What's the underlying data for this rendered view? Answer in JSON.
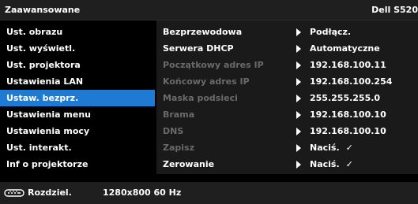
{
  "header": {
    "title": "Zaawansowane",
    "brand": "Dell S520"
  },
  "menu": {
    "items": [
      {
        "label": "Ust. obrazu"
      },
      {
        "label": "Ust. wyświetl."
      },
      {
        "label": "Ust. projektora"
      },
      {
        "label": "Ustawienia LAN"
      },
      {
        "label": "Ustaw. bezprz."
      },
      {
        "label": "Ustawienia menu"
      },
      {
        "label": "Ustawienia mocy"
      },
      {
        "label": "Ust. interakt."
      },
      {
        "label": "Inf o projektorze"
      }
    ],
    "selected_index": 4
  },
  "panel": {
    "rows": [
      {
        "label": "Bezprzewodowa",
        "value": "Podłącz.",
        "dim": false
      },
      {
        "label": "Serwera DHCP",
        "value": "Automatyczne",
        "dim": false
      },
      {
        "label": "Początkowy adres IP",
        "value": "192.168.100.11",
        "dim": true
      },
      {
        "label": "Końcowy adres IP",
        "value": "192.168.100.254",
        "dim": true
      },
      {
        "label": "Maska podsieci",
        "value": "255.255.255.0",
        "dim": true
      },
      {
        "label": "Brama",
        "value": "192.168.100.10",
        "dim": true
      },
      {
        "label": "DNS",
        "value": "192.168.100.10",
        "dim": true
      },
      {
        "label": "Zapisz",
        "value": "Naciś.",
        "check": "✓",
        "dim": true
      },
      {
        "label": "Zerowanie",
        "value": "Naciś.",
        "check": "✓",
        "dim": false
      }
    ]
  },
  "footer": {
    "label": "Rozdziel.",
    "resolution": "1280x800 60 Hz",
    "icon": "monitor-connector-icon"
  },
  "colors": {
    "selected": "#1f7bd2",
    "header_bg": "#1f1f1f",
    "panel_bg": "#1a1a1a",
    "dim_text": "#6a6a6a"
  }
}
